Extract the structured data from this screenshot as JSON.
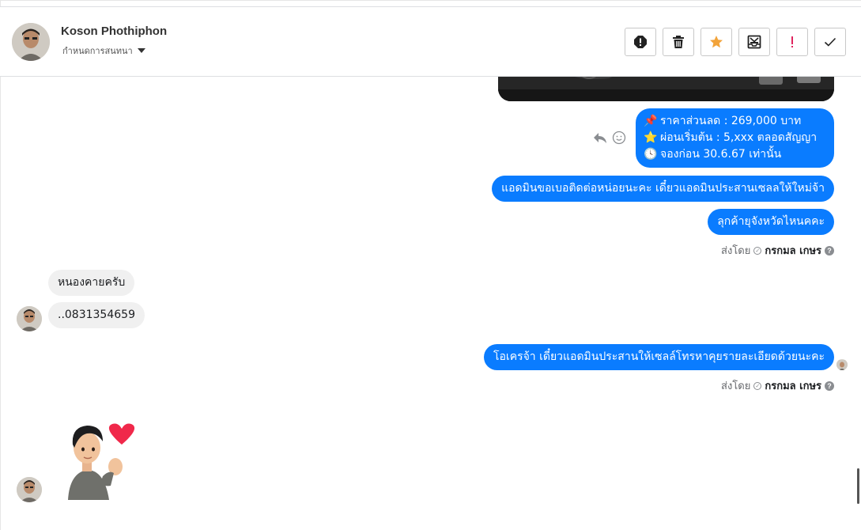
{
  "header": {
    "contact_name": "Koson Phothiphon",
    "assign_label": "กำหนดการสนทนา",
    "tools": [
      {
        "name": "report-icon"
      },
      {
        "name": "trash-icon"
      },
      {
        "name": "star-icon",
        "color": "#f2a33a"
      },
      {
        "name": "mark-unread-icon"
      },
      {
        "name": "important-icon",
        "color": "#e0245e"
      },
      {
        "name": "check-icon"
      }
    ]
  },
  "messages": {
    "promo": {
      "line1_emoji": "📌",
      "line1": "ราคาส่วนลด : 269,000 บาท",
      "line2_emoji": "⭐",
      "line2": "ผ่อนเริ่มต้น : 5,xxx ตลอดสัญญา",
      "line3_emoji": "🕓",
      "line3": "จองก่อน 30.6.67 เท่านั้น"
    },
    "out1": "แอดมินขอเบอติดต่อหน่อยนะคะ เดี๋ยวแอดมินประสานเซลลให้ใหม่จ้า",
    "out2": "ลุกค้ายุจังหวัดไหนคคะ",
    "in1": "หนองคายครับ",
    "in2": "..0831354659",
    "out3": "โอเครจ้า เดี๋ยวแอดมินประสานให้เซลล์โทรหาคุยรายละเอียดด้วยนะคะ"
  },
  "sent_by": {
    "prefix": "ส่งโดย",
    "agent": "กรกมล เกษร"
  },
  "colors": {
    "outgoing_bubble": "#0a7cff",
    "incoming_bubble": "#f0f0f0"
  }
}
